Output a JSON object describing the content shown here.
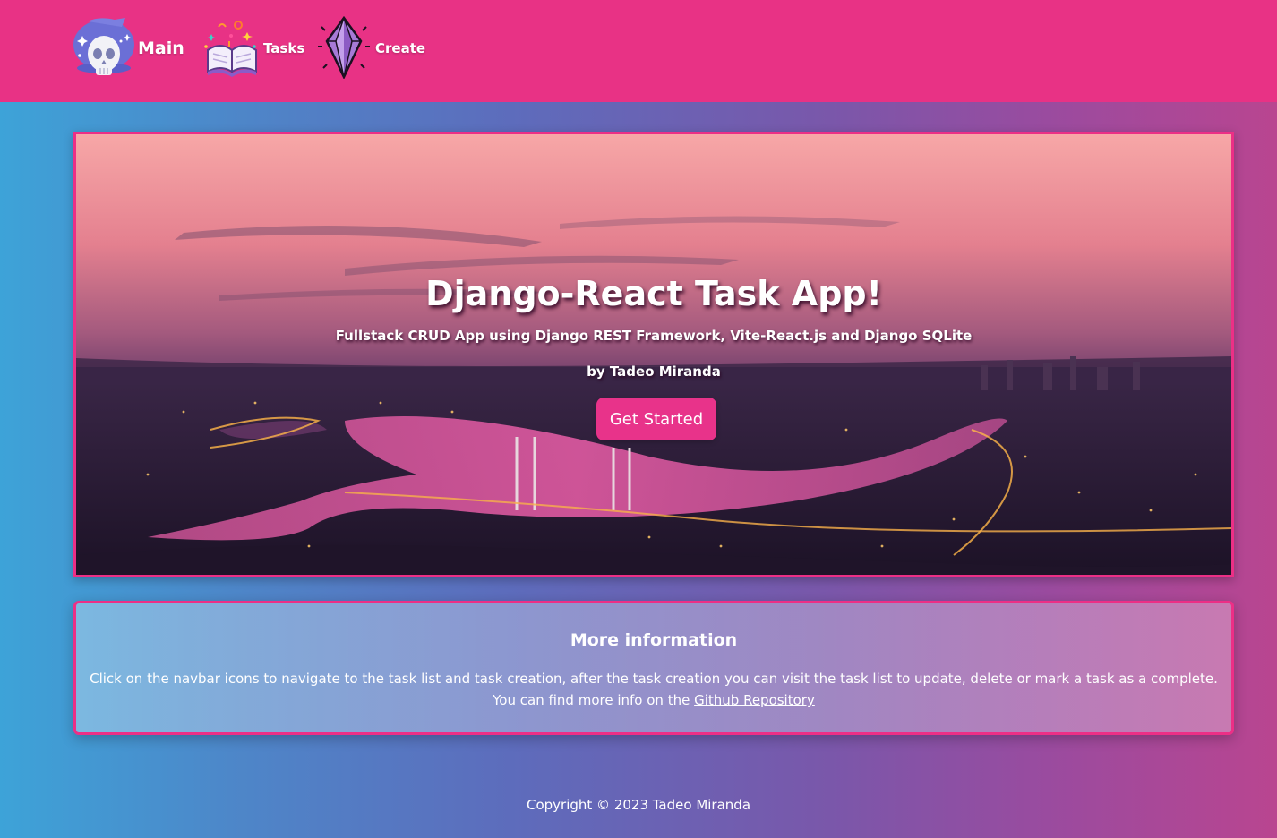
{
  "navbar": {
    "background_color": "#e83285",
    "items": [
      {
        "label": "Main",
        "icon": "skull-icon"
      },
      {
        "label": "Tasks",
        "icon": "magic-book-icon"
      },
      {
        "label": "Create",
        "icon": "crystal-icon"
      }
    ]
  },
  "hero": {
    "title": "Django-React Task App!",
    "subtitle": "Fullstack CRUD App using Django REST Framework, Vite-React.js and Django SQLite",
    "author": "by Tadeo Miranda",
    "button_label": "Get Started",
    "border_color": "#ec2f86"
  },
  "info": {
    "title": "More information",
    "line1": "Click on the navbar icons to navigate to the task list and task creation, after the task creation you can visit the task list to update, delete or mark a task as a complete.",
    "line2_prefix": "You can find more info on the ",
    "link_label": "Github Repository"
  },
  "footer": {
    "copyright": "Copyright © 2023 Tadeo Miranda"
  },
  "colors": {
    "accent": "#e8338a"
  }
}
